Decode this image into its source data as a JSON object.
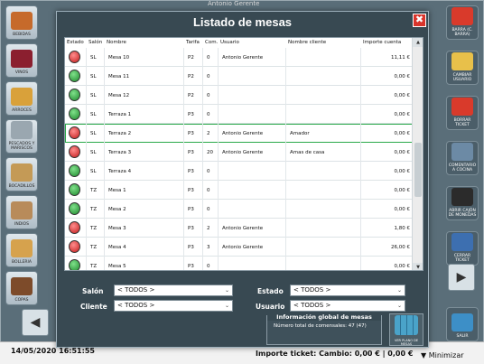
{
  "dialog": {
    "title": "Listado de mesas",
    "close_label": "✖"
  },
  "table": {
    "columns": [
      "Estado",
      "Salón",
      "Nombre",
      "Tarifa",
      "Com.",
      "Usuario",
      "Nombre cliente",
      "Importe cuenta"
    ],
    "rows": [
      {
        "estado": "red",
        "salon": "SL",
        "nombre": "Mesa 10",
        "tarifa": "P2",
        "com": "0",
        "usuario": "Antonio Gerente",
        "cliente": "",
        "importe": "11,11 €"
      },
      {
        "estado": "green",
        "salon": "SL",
        "nombre": "Mesa 11",
        "tarifa": "P2",
        "com": "0",
        "usuario": "",
        "cliente": "",
        "importe": "0,00 €"
      },
      {
        "estado": "green",
        "salon": "SL",
        "nombre": "Mesa 12",
        "tarifa": "P2",
        "com": "0",
        "usuario": "",
        "cliente": "",
        "importe": "0,00 €"
      },
      {
        "estado": "green",
        "salon": "SL",
        "nombre": "Terraza 1",
        "tarifa": "P3",
        "com": "0",
        "usuario": "",
        "cliente": "",
        "importe": "0,00 €"
      },
      {
        "estado": "red",
        "salon": "SL",
        "nombre": "Terraza 2",
        "tarifa": "P3",
        "com": "2",
        "usuario": "Antonio Gerente",
        "cliente": "Amador",
        "importe": "0,00 €",
        "selected": true
      },
      {
        "estado": "red",
        "salon": "SL",
        "nombre": "Terraza 3",
        "tarifa": "P3",
        "com": "20",
        "usuario": "Antonio Gerente",
        "cliente": "Amas de casa",
        "importe": "0,00 €"
      },
      {
        "estado": "green",
        "salon": "SL",
        "nombre": "Terraza 4",
        "tarifa": "P3",
        "com": "0",
        "usuario": "",
        "cliente": "",
        "importe": "0,00 €"
      },
      {
        "estado": "green",
        "salon": "TZ",
        "nombre": "Mesa 1",
        "tarifa": "P3",
        "com": "0",
        "usuario": "",
        "cliente": "",
        "importe": "0,00 €"
      },
      {
        "estado": "green",
        "salon": "TZ",
        "nombre": "Mesa 2",
        "tarifa": "P3",
        "com": "0",
        "usuario": "",
        "cliente": "",
        "importe": "0,00 €"
      },
      {
        "estado": "red",
        "salon": "TZ",
        "nombre": "Mesa 3",
        "tarifa": "P3",
        "com": "2",
        "usuario": "Antonio Gerente",
        "cliente": "",
        "importe": "1,80 €"
      },
      {
        "estado": "red",
        "salon": "TZ",
        "nombre": "Mesa 4",
        "tarifa": "P3",
        "com": "3",
        "usuario": "Antonio Gerente",
        "cliente": "",
        "importe": "26,00 €"
      },
      {
        "estado": "green",
        "salon": "TZ",
        "nombre": "Mesa 5",
        "tarifa": "P3",
        "com": "0",
        "usuario": "",
        "cliente": "",
        "importe": "0,00 €"
      }
    ]
  },
  "filters": {
    "salon_label": "Salón",
    "salon_value": "< TODOS >",
    "cliente_label": "Cliente",
    "cliente_value": "< TODOS >",
    "estado_label": "Estado",
    "estado_value": "< TODOS >",
    "usuario_label": "Usuario",
    "usuario_value": "< TODOS >"
  },
  "info": {
    "title": "Información global de mesas",
    "text": "Número total de comensales: 47 (47)"
  },
  "plan_button": {
    "label": "VER PLANO DE MESAS"
  },
  "background": {
    "left_tiles": [
      "BEBIDAS",
      "VINOS",
      "ARROCES",
      "PESCADOS Y MARISCOS",
      "BOCADILLOS",
      "INDIOS",
      "BOLLERIA",
      "COPAS"
    ],
    "right_tiles": [
      "BARRA (C. BARRA)",
      "CAMBIAR USUARIO",
      "BORRAR TICKET",
      "COMENTARIO A COCINA",
      "ABRIR CAJÓN DE MONEDAS",
      "CERRAR TICKET",
      "SALIR"
    ],
    "date_time": "14/05/2020 16:51:55",
    "totals": "Importe ticket: Cambio:  0,00 € | 0,00 €",
    "minimize_label": "▼ Minimizar",
    "top_hidden": "Antonio Gerente"
  },
  "colors": {
    "dialog_bg": "#384952",
    "status_free": "#1f8a2e",
    "status_busy": "#c31d1d",
    "selection": "#2aa94a"
  }
}
